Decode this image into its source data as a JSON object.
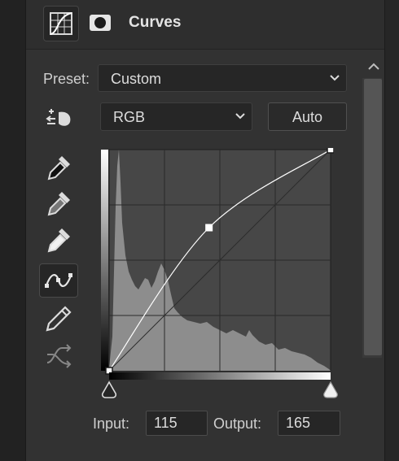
{
  "panel": {
    "title": "Curves",
    "icons": [
      "curves-adjustment-icon",
      "layer-mask-icon"
    ]
  },
  "preset": {
    "label": "Preset:",
    "value": "Custom"
  },
  "channel": {
    "value": "RGB"
  },
  "auto_button": {
    "label": "Auto"
  },
  "tools": [
    {
      "name": "on-image-adjust-icon"
    },
    {
      "name": "black-point-eyedropper-icon"
    },
    {
      "name": "gray-point-eyedropper-icon"
    },
    {
      "name": "white-point-eyedropper-icon"
    },
    {
      "name": "edit-curve-points-icon",
      "active": true
    },
    {
      "name": "draw-curve-pencil-icon"
    },
    {
      "name": "smooth-curve-icon",
      "disabled": true
    }
  ],
  "io": {
    "input_label": "Input:",
    "input_value": "115",
    "output_label": "Output:",
    "output_value": "165"
  },
  "curve": {
    "points": [
      [
        0,
        0
      ],
      [
        115,
        165
      ],
      [
        255,
        255
      ]
    ],
    "selected_point": [
      115,
      165
    ],
    "range": [
      0,
      255
    ]
  },
  "colors": {
    "panel_bg": "#323232",
    "graph_bg": "#474747",
    "histogram": "#8d8d8d",
    "curve": "#ffffff"
  }
}
